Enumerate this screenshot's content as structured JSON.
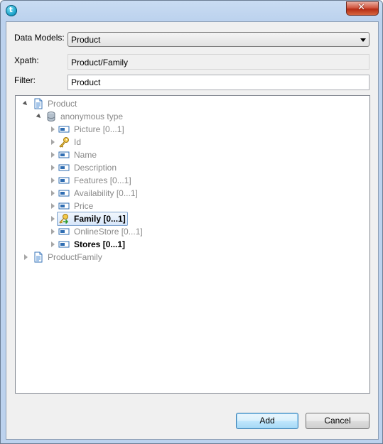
{
  "window": {
    "title": ""
  },
  "form": {
    "data_models_label": "Data Models:",
    "data_models_value": "Product",
    "xpath_label": "Xpath:",
    "xpath_value": "Product/Family",
    "filter_label": "Filter:",
    "filter_value": "Product"
  },
  "tree": {
    "root": "Product",
    "type_node": "anonymous type",
    "children": [
      {
        "label": "Picture",
        "card": "[0...1]"
      },
      {
        "label": "Id",
        "card": ""
      },
      {
        "label": "Name",
        "card": ""
      },
      {
        "label": "Description",
        "card": ""
      },
      {
        "label": "Features",
        "card": "[0...1]"
      },
      {
        "label": "Availability",
        "card": "[0...1]"
      },
      {
        "label": "Price",
        "card": ""
      },
      {
        "label": "Family",
        "card": "[0...1]"
      },
      {
        "label": "OnlineStore",
        "card": "[0...1]"
      },
      {
        "label": "Stores",
        "card": "[0...1]"
      }
    ],
    "root2": "ProductFamily"
  },
  "buttons": {
    "add": "Add",
    "cancel": "Cancel"
  },
  "icons": {
    "app": "talend-app-icon",
    "document": "document-icon",
    "type": "complex-type-icon",
    "element": "element-icon",
    "key": "key-icon",
    "foreign_key": "foreign-key-icon"
  },
  "colors": {
    "selection": "#d6e6fa",
    "close_button": "#c8432c",
    "default_button": "#3c7fb1"
  }
}
